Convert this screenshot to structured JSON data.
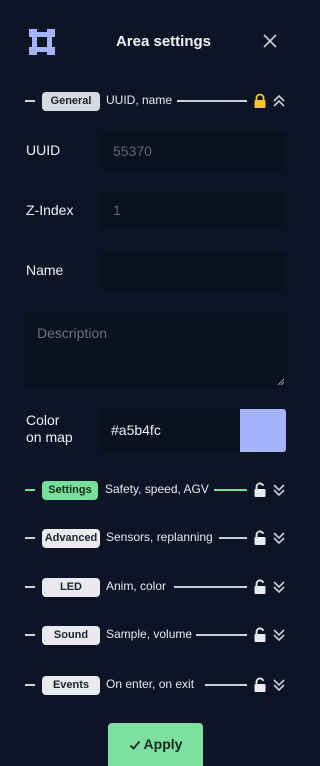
{
  "header": {
    "title": "Area settings"
  },
  "sections": {
    "general": {
      "label": "General",
      "description": "UUID, name"
    },
    "settings": {
      "label": "Settings",
      "description": "Safety, speed, AGV"
    },
    "advanced": {
      "label": "Advanced",
      "description": "Sensors, replanning"
    },
    "led": {
      "label": "LED",
      "description": "Anim, color"
    },
    "sound": {
      "label": "Sound",
      "description": "Sample, volume"
    },
    "events": {
      "label": "Events",
      "description": "On enter, on exit"
    }
  },
  "fields": {
    "uuid": {
      "label": "UUID",
      "value": "55370"
    },
    "zindex": {
      "label": "Z-Index",
      "value": "1"
    },
    "name": {
      "label": "Name",
      "value": ""
    },
    "description": {
      "placeholder": "Description"
    },
    "color": {
      "label_line1": "Color",
      "label_line2": "on map",
      "value": "#a5b4fc"
    }
  },
  "apply_label": "Apply",
  "colors": {
    "background": "#0c1526",
    "input_bg": "#0a111f",
    "accent_green": "#76e09a",
    "lock_active": "#f5c32c",
    "swatch": "#a5b4fc"
  }
}
